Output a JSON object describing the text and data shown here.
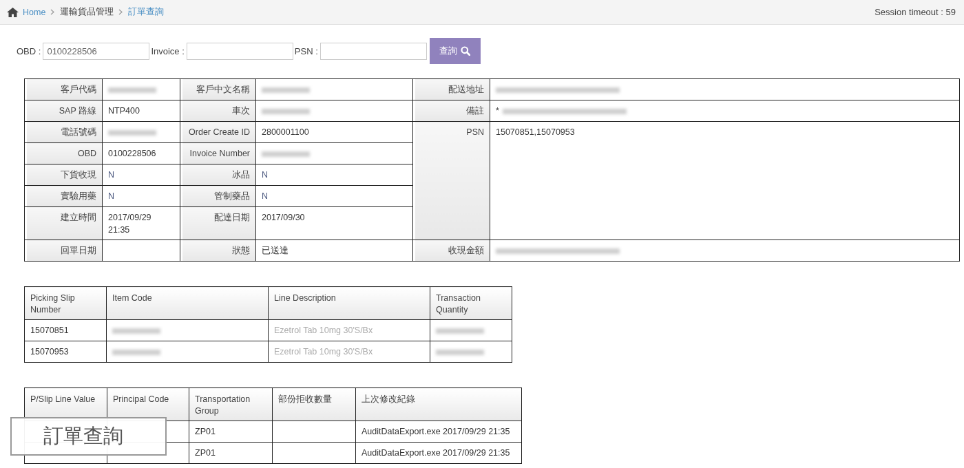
{
  "breadcrumb": [
    {
      "label": "Home",
      "kind": "home"
    },
    {
      "label": "運輸貨品管理",
      "kind": "plain"
    },
    {
      "label": "訂單查詢",
      "kind": "current"
    }
  ],
  "session": "Session timeout : 59",
  "search": {
    "fields": [
      {
        "label": "OBD :",
        "value": "0100228506"
      },
      {
        "label": "Invoice :"
      },
      {
        "label": "PSN :"
      }
    ],
    "button": "查詢"
  },
  "details": {
    "left_rows": [
      [
        {
          "label": "客戶代碼",
          "redacted": true
        },
        {
          "label": "客戶中文名稱",
          "redacted": true
        }
      ],
      [
        {
          "label": "SAP 路線",
          "value": "NTP400"
        },
        {
          "label": "車次",
          "redacted": true
        }
      ],
      [
        {
          "label": "電話號碼",
          "redacted": true
        },
        {
          "label": "Order Create ID",
          "value": "2800001100"
        }
      ],
      [
        {
          "label": "OBD",
          "value": "0100228506"
        },
        {
          "label": "Invoice Number",
          "redacted": true
        }
      ],
      [
        {
          "label": "下貨收現",
          "value": "N",
          "kind": "flag"
        },
        {
          "label": "冰品",
          "value": "N",
          "kind": "flag"
        }
      ],
      [
        {
          "label": "實驗用藥",
          "value": "N",
          "kind": "flag"
        },
        {
          "label": "管制藥品",
          "value": "N",
          "kind": "flag"
        }
      ],
      [
        {
          "label": "建立時間",
          "value": "2017/09/29 21:35",
          "kind": "tall"
        },
        {
          "label": "配達日期",
          "value": "2017/09/30"
        }
      ],
      [
        {
          "label": "回單日期"
        },
        {
          "label": "狀態",
          "value": "已送達"
        }
      ]
    ],
    "right": [
      {
        "label": "配送地址",
        "redacted": true,
        "kind": "short"
      },
      {
        "label": "備註",
        "value": "*",
        "redacted": true,
        "kind": "short"
      },
      {
        "label": "PSN",
        "value": "15070851,15070953",
        "kind": "tall"
      },
      {
        "label": "收現金額",
        "redacted": true,
        "kind": "short"
      }
    ]
  },
  "picking": {
    "columns": [
      "Picking Slip Number",
      "Item Code",
      "Line Description",
      "Transaction Quantity"
    ],
    "rows": [
      [
        {
          "text": "15070851"
        },
        {
          "redacted": true
        },
        {
          "text": "Ezetrol Tab 10mg 30'S/Bx",
          "kind": "faint"
        },
        {
          "redacted": true
        }
      ],
      [
        {
          "text": "15070953"
        },
        {
          "redacted": true
        },
        {
          "text": "Ezetrol Tab 10mg 30'S/Bx",
          "kind": "faint"
        },
        {
          "redacted": true
        }
      ]
    ]
  },
  "lines": {
    "columns": [
      "P/Slip Line Value",
      "Principal Code",
      "Transportation Group",
      "部份拒收數量",
      "上次修改紀錄"
    ],
    "rows": [
      [
        {},
        {},
        {
          "text": "ZP01"
        },
        {},
        {
          "text": "AuditDataExport.exe 2017/09/29 21:35"
        }
      ],
      [
        {},
        {},
        {
          "text": "ZP01"
        },
        {},
        {
          "text": "AuditDataExport.exe 2017/09/29 21:35"
        }
      ]
    ]
  },
  "overlay": {
    "title": "訂單查詢"
  }
}
